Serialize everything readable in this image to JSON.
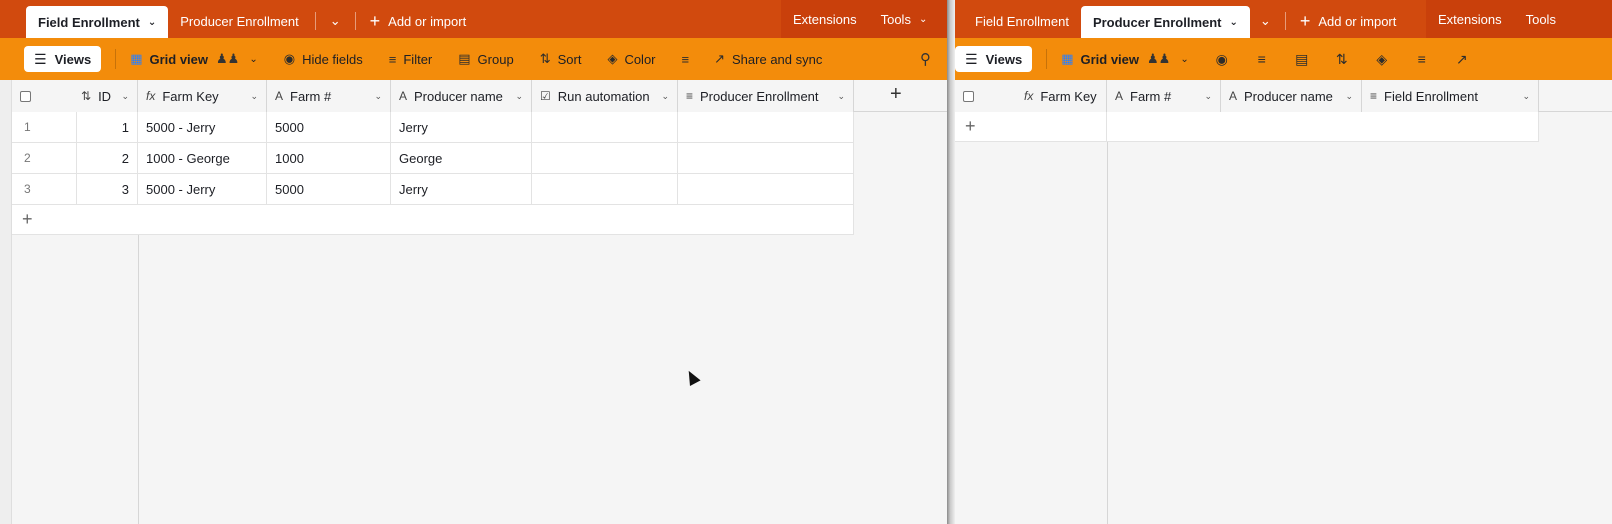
{
  "left": {
    "tabs": [
      {
        "label": "Field Enrollment",
        "active": true
      },
      {
        "label": "Producer Enrollment",
        "active": false
      }
    ],
    "add_import": "Add or import",
    "extensions": "Extensions",
    "tools": "Tools",
    "toolbar": {
      "views": "Views",
      "grid_view": "Grid view",
      "hide_fields": "Hide fields",
      "filter": "Filter",
      "group": "Group",
      "sort": "Sort",
      "color": "Color",
      "share_sync": "Share and sync"
    },
    "columns": [
      "ID",
      "Farm Key",
      "Farm #",
      "Producer name",
      "Run automation",
      "Producer Enrollment"
    ],
    "rows": [
      {
        "num": "1",
        "id": "1",
        "farm_key": "5000 - Jerry",
        "farm_no": "5000",
        "producer": "Jerry",
        "run": "",
        "enrollment": ""
      },
      {
        "num": "2",
        "id": "2",
        "farm_key": "1000 - George",
        "farm_no": "1000",
        "producer": "George",
        "run": "",
        "enrollment": ""
      },
      {
        "num": "3",
        "id": "3",
        "farm_key": "5000 - Jerry",
        "farm_no": "5000",
        "producer": "Jerry",
        "run": "",
        "enrollment": ""
      }
    ]
  },
  "right": {
    "tabs": [
      {
        "label": "Field Enrollment",
        "active": false
      },
      {
        "label": "Producer Enrollment",
        "active": true
      }
    ],
    "add_import": "Add or import",
    "extensions": "Extensions",
    "tools": "Tools",
    "toolbar": {
      "views": "Views",
      "grid_view": "Grid view"
    },
    "columns": [
      "Farm Key",
      "Farm #",
      "Producer name",
      "Field Enrollment"
    ]
  },
  "colors": {
    "tabbar": "#d14a0e",
    "toolbar": "#f38c0b",
    "grid_bg": "#f5f5f5"
  },
  "icons": [
    "chevron-down-icon",
    "plus-icon",
    "hamburger-icon",
    "grid-icon",
    "people-icon",
    "eye-slash-icon",
    "filter-icon",
    "group-icon",
    "sort-icon",
    "paint-bucket-icon",
    "row-height-icon",
    "share-icon",
    "search-icon",
    "formula-icon",
    "text-icon",
    "number-sort-icon",
    "checkbox-icon",
    "link-icon"
  ]
}
